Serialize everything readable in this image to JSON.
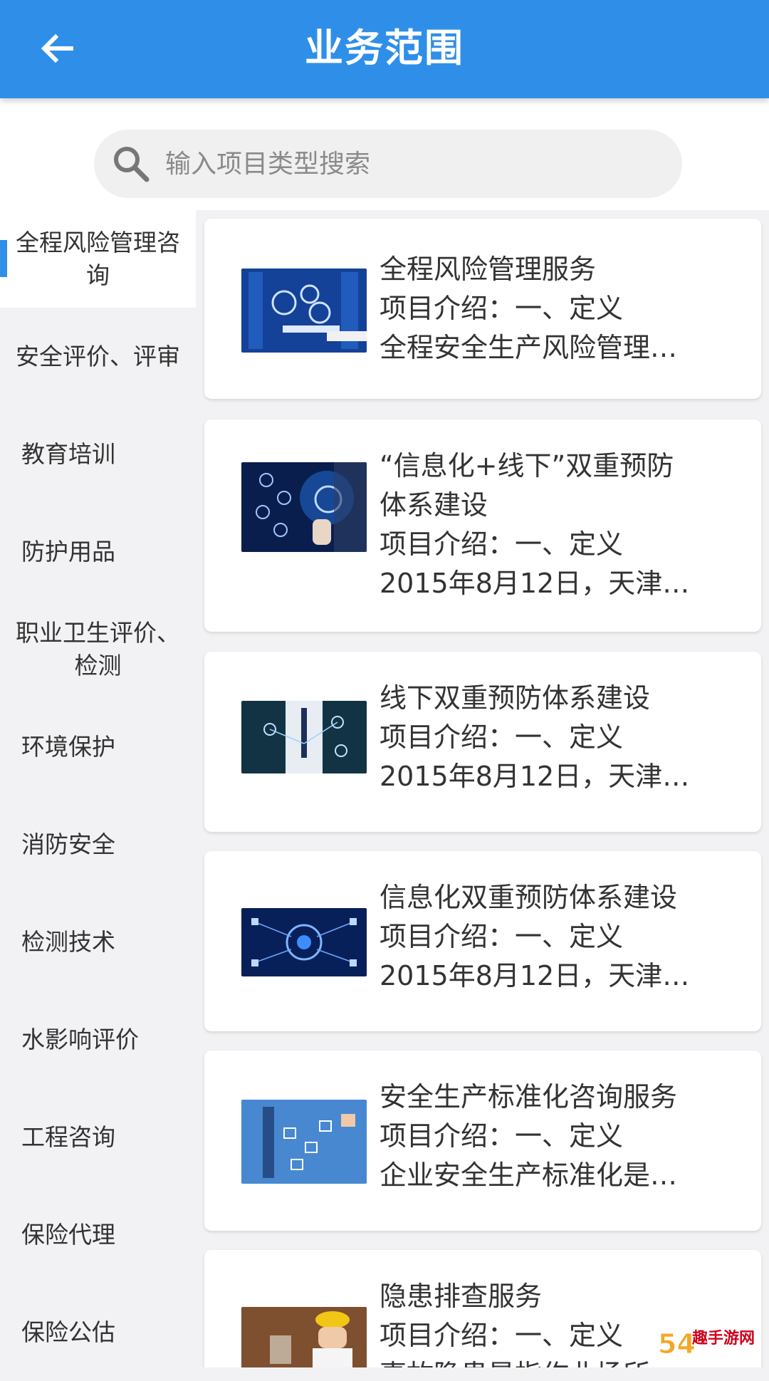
{
  "header": {
    "title": "业务范围",
    "back_icon": "arrow-left-icon"
  },
  "search": {
    "placeholder": "输入项目类型搜索",
    "value": ""
  },
  "sidebar": {
    "items": [
      {
        "label": "全程风险管理咨询",
        "active": true
      },
      {
        "label": "安全评价、评审"
      },
      {
        "label": "教育培训"
      },
      {
        "label": "防护用品"
      },
      {
        "label": "职业卫生评价、检测"
      },
      {
        "label": "环境保护"
      },
      {
        "label": "消防安全"
      },
      {
        "label": "检测技术"
      },
      {
        "label": "水影响评价"
      },
      {
        "label": "工程咨询"
      },
      {
        "label": "保险代理"
      },
      {
        "label": "保险公估"
      }
    ]
  },
  "cards": [
    {
      "title": "全程风险管理服务",
      "intro": "项目介绍：一、定义",
      "desc": "全程安全生产风险管理…"
    },
    {
      "title_line1": "“信息化+线下”双重预防",
      "title_line2": "体系建设",
      "intro": "项目介绍：一、定义",
      "desc": "2015年8月12日，天津…"
    },
    {
      "title": "线下双重预防体系建设",
      "intro": "项目介绍：一、定义",
      "desc": "2015年8月12日，天津…"
    },
    {
      "title": "信息化双重预防体系建设",
      "intro": "项目介绍：一、定义",
      "desc": "2015年8月12日，天津…"
    },
    {
      "title": "安全生产标准化咨询服务",
      "intro": "项目介绍：一、定义",
      "desc": "企业安全生产标准化是…"
    },
    {
      "title": "隐患排查服务",
      "intro": "项目介绍：一、定义",
      "desc": "事故隐患是指作业场所…"
    }
  ],
  "watermark": {
    "text": "54趣手游网"
  },
  "colors": {
    "primary": "#2f8fe8",
    "background": "#f2f2f4",
    "card": "#ffffff"
  }
}
